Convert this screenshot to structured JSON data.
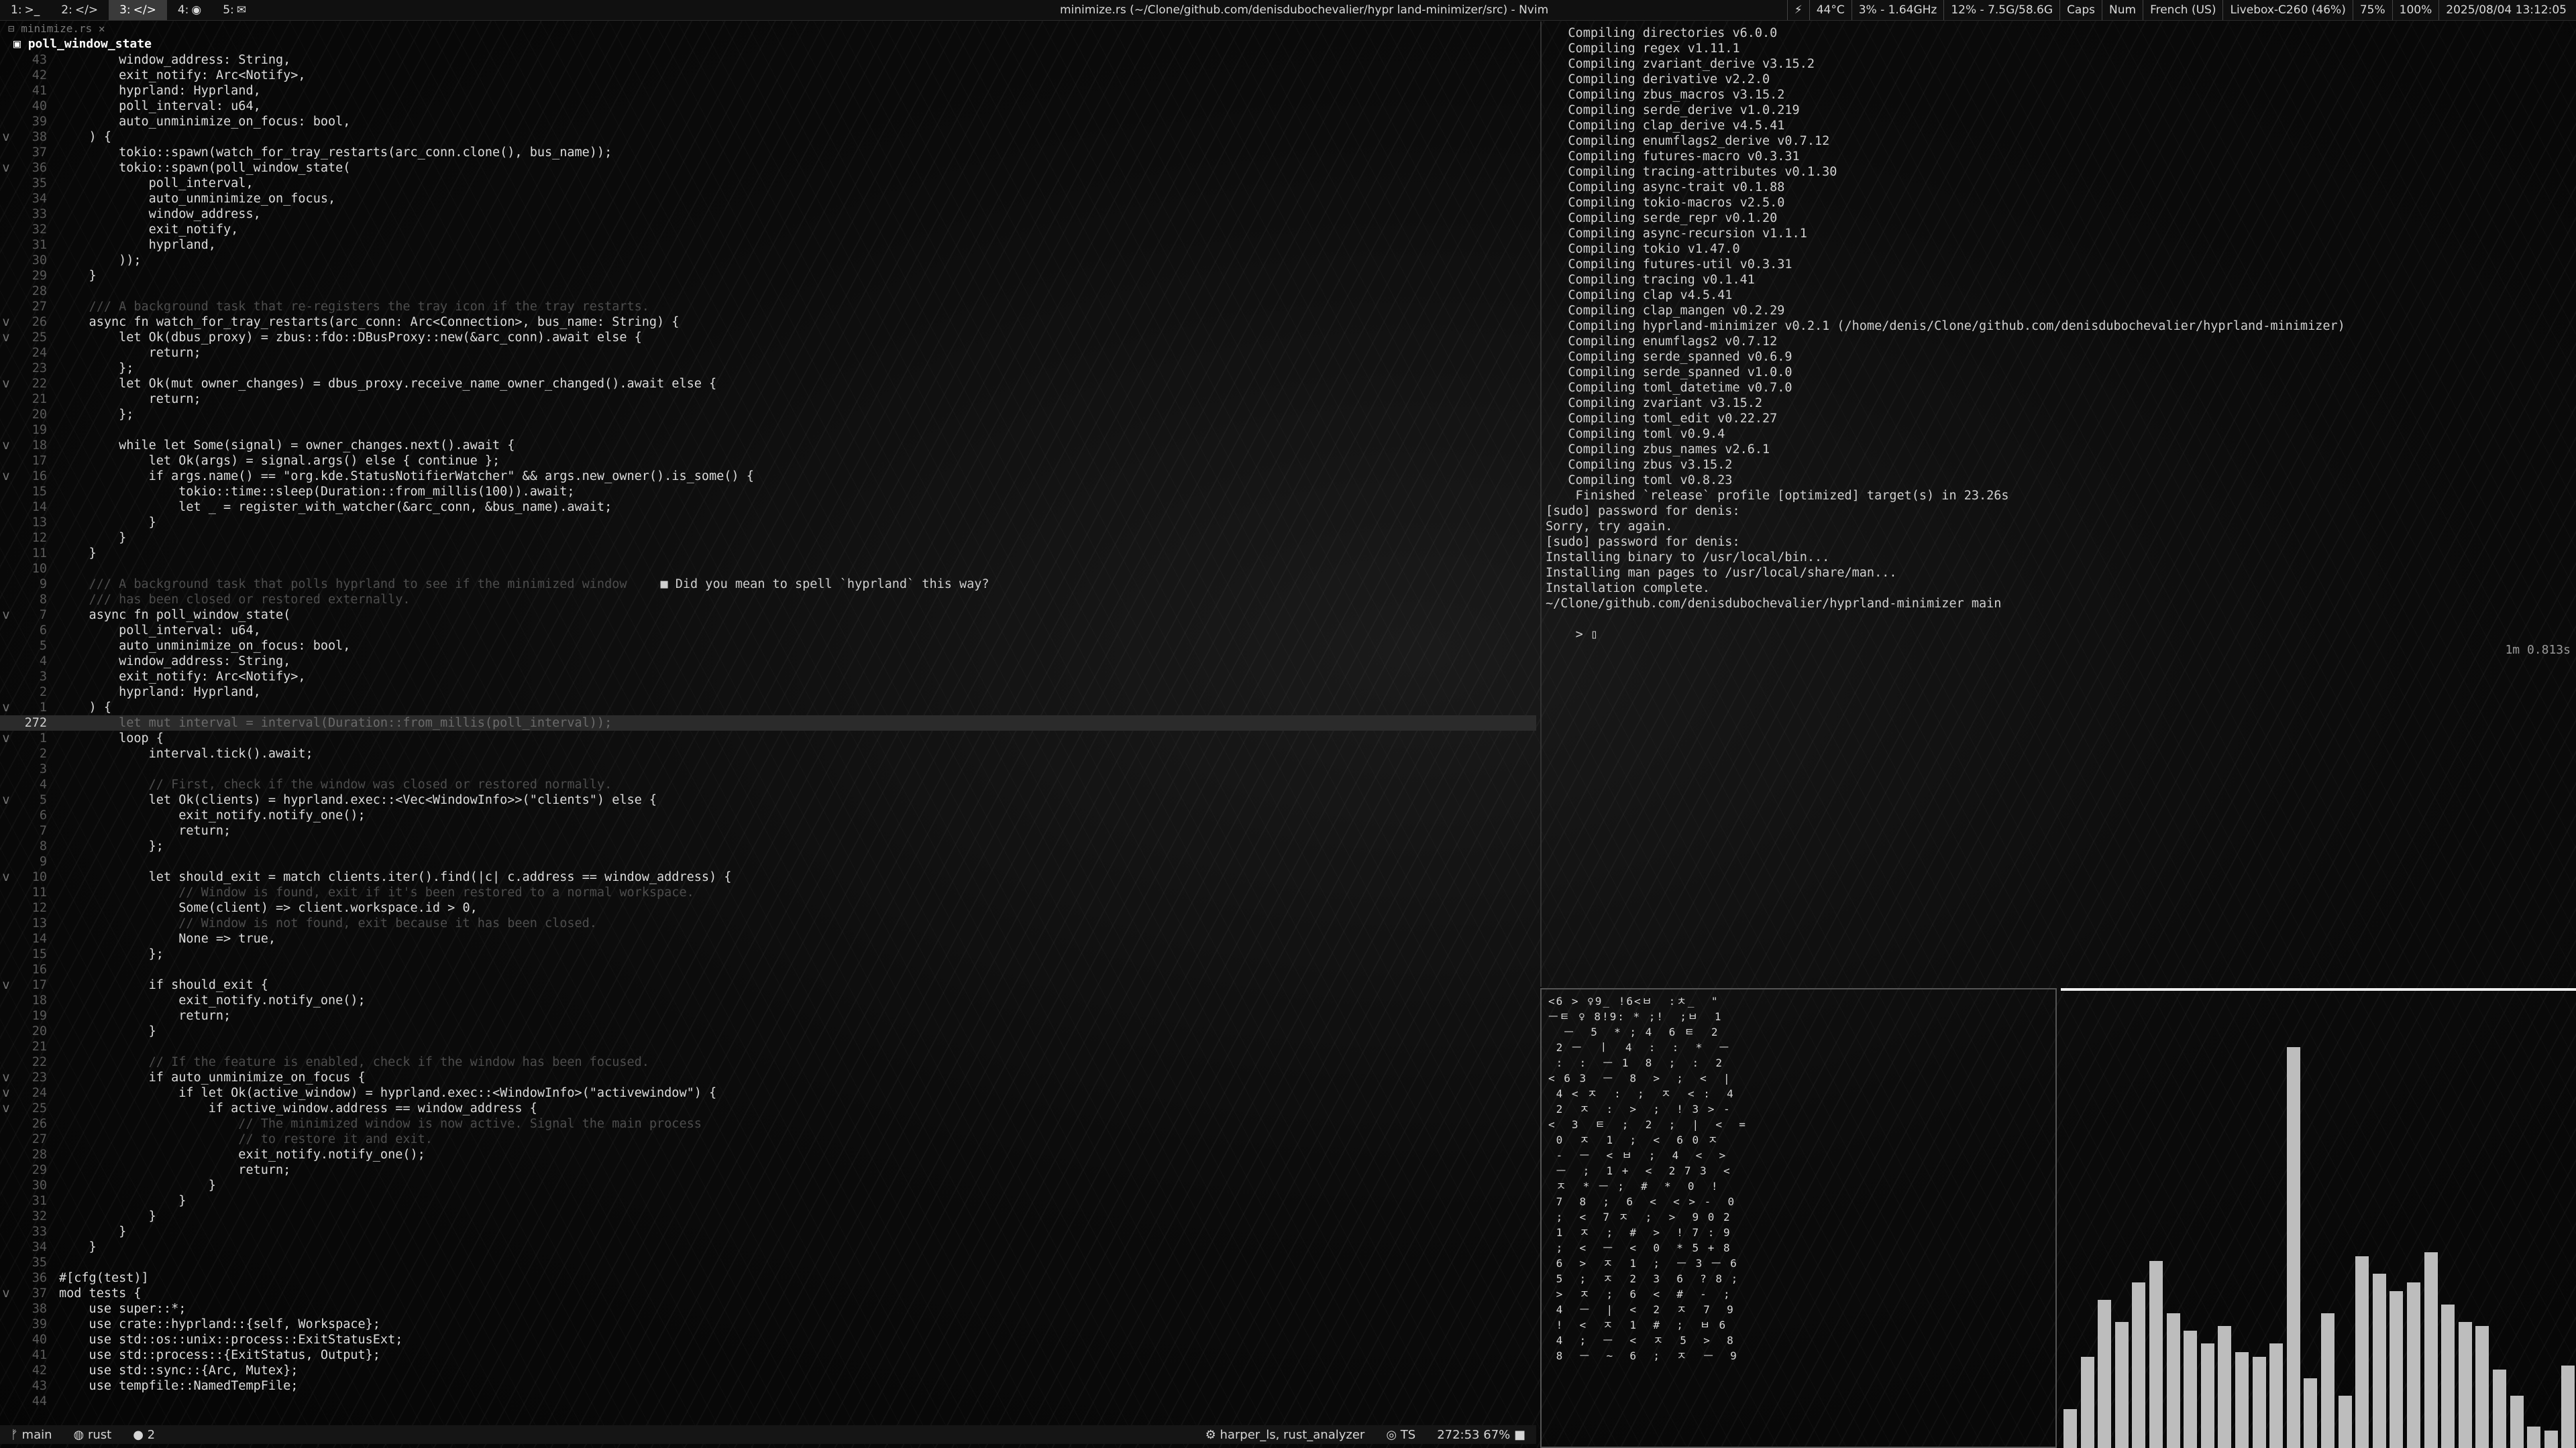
{
  "topbar": {
    "workspaces": [
      {
        "label": "1:",
        "icon": "terminal-icon"
      },
      {
        "label": "2:",
        "icon": "code-icon"
      },
      {
        "label": "3:",
        "icon": "code-icon"
      },
      {
        "label": "4:",
        "icon": "globe-icon"
      },
      {
        "label": "5:",
        "icon": "chat-icon"
      }
    ],
    "active_workspace": "3:",
    "window_title": "minimize.rs (~/Clone/github.com/denisdubochevalier/hypr land-minimizer/src) - Nvim",
    "modules": [
      "⚡",
      "44°C",
      "3% - 1.64GHz",
      "12% - 7.5G/58.6G",
      "Caps",
      "Num",
      "French (US)",
      "Livebox-C260 (46%)",
      "75%",
      "100%",
      "2025/08/04 13:12:05"
    ]
  },
  "nvim": {
    "tab": "minimize.rs",
    "winbar": "poll_window_state",
    "lines": [
      {
        "n": "43",
        "t": "        window_address: String,"
      },
      {
        "n": "42",
        "t": "        exit_notify: Arc<Notify>,"
      },
      {
        "n": "41",
        "t": "        hyprland: Hyprland,"
      },
      {
        "n": "40",
        "t": "        poll_interval: u64,"
      },
      {
        "n": "39",
        "t": "        auto_unminimize_on_focus: bool,"
      },
      {
        "n": "38",
        "t": "    ) {",
        "f": "v"
      },
      {
        "n": "37",
        "t": "        tokio::spawn(watch_for_tray_restarts(arc_conn.clone(), bus_name));"
      },
      {
        "n": "36",
        "t": "        tokio::spawn(poll_window_state(",
        "f": "v"
      },
      {
        "n": "35",
        "t": "            poll_interval,"
      },
      {
        "n": "34",
        "t": "            auto_unminimize_on_focus,"
      },
      {
        "n": "33",
        "t": "            window_address,"
      },
      {
        "n": "32",
        "t": "            exit_notify,"
      },
      {
        "n": "31",
        "t": "            hyprland,"
      },
      {
        "n": "30",
        "t": "        ));"
      },
      {
        "n": "29",
        "t": "    }"
      },
      {
        "n": "28",
        "t": ""
      },
      {
        "n": "27",
        "t": "    /// A background task that re-registers the tray icon if the tray restarts.",
        "c": true
      },
      {
        "n": "26",
        "t": "    async fn watch_for_tray_restarts(arc_conn: Arc<Connection>, bus_name: String) {",
        "f": "v"
      },
      {
        "n": "25",
        "t": "        let Ok(dbus_proxy) = zbus::fdo::DBusProxy::new(&arc_conn).await else {",
        "f": "v"
      },
      {
        "n": "24",
        "t": "            return;"
      },
      {
        "n": "23",
        "t": "        };"
      },
      {
        "n": "22",
        "t": "        let Ok(mut owner_changes) = dbus_proxy.receive_name_owner_changed().await else {",
        "f": "v"
      },
      {
        "n": "21",
        "t": "            return;"
      },
      {
        "n": "20",
        "t": "        };"
      },
      {
        "n": "19",
        "t": ""
      },
      {
        "n": "18",
        "t": "        while let Some(signal) = owner_changes.next().await {",
        "f": "v"
      },
      {
        "n": "17",
        "t": "            let Ok(args) = signal.args() else { continue };"
      },
      {
        "n": "16",
        "t": "            if args.name() == \"org.kde.StatusNotifierWatcher\" && args.new_owner().is_some() {",
        "f": "v"
      },
      {
        "n": "15",
        "t": "                tokio::time::sleep(Duration::from_millis(100)).await;"
      },
      {
        "n": "14",
        "t": "                let _ = register_with_watcher(&arc_conn, &bus_name).await;"
      },
      {
        "n": "13",
        "t": "            }"
      },
      {
        "n": "12",
        "t": "        }"
      },
      {
        "n": "11",
        "t": "    }"
      },
      {
        "n": "10",
        "t": ""
      },
      {
        "n": "9",
        "t": "    /// A background task that polls hyprland to see if the minimized window",
        "c": true,
        "diag": "■ Did you mean to spell `hyprland` this way?"
      },
      {
        "n": "8",
        "t": "    /// has been closed or restored externally.",
        "c": true
      },
      {
        "n": "7",
        "t": "    async fn poll_window_state(",
        "f": "v"
      },
      {
        "n": "6",
        "t": "        poll_interval: u64,"
      },
      {
        "n": "5",
        "t": "        auto_unminimize_on_focus: bool,"
      },
      {
        "n": "4",
        "t": "        window_address: String,"
      },
      {
        "n": "3",
        "t": "        exit_notify: Arc<Notify>,"
      },
      {
        "n": "2",
        "t": "        hyprland: Hyprland,"
      },
      {
        "n": "1",
        "t": "    ) {",
        "f": "v"
      },
      {
        "n": "272",
        "t": "        let mut interval = interval(Duration::from_millis(poll_interval));",
        "cur": true
      },
      {
        "n": "1",
        "t": "        loop {",
        "f": "v"
      },
      {
        "n": "2",
        "t": "            interval.tick().await;"
      },
      {
        "n": "3",
        "t": ""
      },
      {
        "n": "4",
        "t": "            // First, check if the window was closed or restored normally.",
        "c": true
      },
      {
        "n": "5",
        "t": "            let Ok(clients) = hyprland.exec::<Vec<WindowInfo>>(\"clients\") else {",
        "f": "v"
      },
      {
        "n": "6",
        "t": "                exit_notify.notify_one();"
      },
      {
        "n": "7",
        "t": "                return;"
      },
      {
        "n": "8",
        "t": "            };"
      },
      {
        "n": "9",
        "t": ""
      },
      {
        "n": "10",
        "t": "            let should_exit = match clients.iter().find(|c| c.address == window_address) {",
        "f": "v"
      },
      {
        "n": "11",
        "t": "                // Window is found, exit if it's been restored to a normal workspace.",
        "c": true
      },
      {
        "n": "12",
        "t": "                Some(client) => client.workspace.id > 0,"
      },
      {
        "n": "13",
        "t": "                // Window is not found, exit because it has been closed.",
        "c": true
      },
      {
        "n": "14",
        "t": "                None => true,"
      },
      {
        "n": "15",
        "t": "            };"
      },
      {
        "n": "16",
        "t": ""
      },
      {
        "n": "17",
        "t": "            if should_exit {",
        "f": "v"
      },
      {
        "n": "18",
        "t": "                exit_notify.notify_one();"
      },
      {
        "n": "19",
        "t": "                return;"
      },
      {
        "n": "20",
        "t": "            }"
      },
      {
        "n": "21",
        "t": ""
      },
      {
        "n": "22",
        "t": "            // If the feature is enabled, check if the window has been focused.",
        "c": true
      },
      {
        "n": "23",
        "t": "            if auto_unminimize_on_focus {",
        "f": "v"
      },
      {
        "n": "24",
        "t": "                if let Ok(active_window) = hyprland.exec::<WindowInfo>(\"activewindow\") {",
        "f": "v"
      },
      {
        "n": "25",
        "t": "                    if active_window.address == window_address {",
        "f": "v"
      },
      {
        "n": "26",
        "t": "                        // The minimized window is now active. Signal the main process",
        "c": true
      },
      {
        "n": "27",
        "t": "                        // to restore it and exit.",
        "c": true
      },
      {
        "n": "28",
        "t": "                        exit_notify.notify_one();"
      },
      {
        "n": "29",
        "t": "                        return;"
      },
      {
        "n": "30",
        "t": "                    }"
      },
      {
        "n": "31",
        "t": "                }"
      },
      {
        "n": "32",
        "t": "            }"
      },
      {
        "n": "33",
        "t": "        }"
      },
      {
        "n": "34",
        "t": "    }"
      },
      {
        "n": "35",
        "t": ""
      },
      {
        "n": "36",
        "t": "#[cfg(test)]"
      },
      {
        "n": "37",
        "t": "mod tests {",
        "f": "v"
      },
      {
        "n": "38",
        "t": "    use super::*;"
      },
      {
        "n": "39",
        "t": "    use crate::hyprland::{self, Workspace};"
      },
      {
        "n": "40",
        "t": "    use std::os::unix::process::ExitStatusExt;"
      },
      {
        "n": "41",
        "t": "    use std::process::{ExitStatus, Output};"
      },
      {
        "n": "42",
        "t": "    use std::sync::{Arc, Mutex};"
      },
      {
        "n": "43",
        "t": "    use tempfile::NamedTempFile;"
      },
      {
        "n": "44",
        "t": ""
      }
    ],
    "status": {
      "branch": "main",
      "lang": "rust",
      "diagnostics": "2",
      "lsp": "harper_ls, rust_analyzer",
      "ts": "TS",
      "position": "272:53",
      "percent": "67%"
    }
  },
  "terminal": {
    "lines": [
      "   Compiling directories v6.0.0",
      "   Compiling regex v1.11.1",
      "   Compiling zvariant_derive v3.15.2",
      "   Compiling derivative v2.2.0",
      "   Compiling zbus_macros v3.15.2",
      "   Compiling serde_derive v1.0.219",
      "   Compiling clap_derive v4.5.41",
      "   Compiling enumflags2_derive v0.7.12",
      "   Compiling futures-macro v0.3.31",
      "   Compiling tracing-attributes v0.1.30",
      "   Compiling async-trait v0.1.88",
      "   Compiling tokio-macros v2.5.0",
      "   Compiling serde_repr v0.1.20",
      "   Compiling async-recursion v1.1.1",
      "   Compiling tokio v1.47.0",
      "   Compiling futures-util v0.3.31",
      "   Compiling tracing v0.1.41",
      "   Compiling clap v4.5.41",
      "   Compiling clap_mangen v0.2.29",
      "   Compiling hyprland-minimizer v0.2.1 (/home/denis/Clone/github.com/denisdubochevalier/hyprland-minimizer)",
      "   Compiling enumflags2 v0.7.12",
      "   Compiling serde_spanned v0.6.9",
      "   Compiling serde_spanned v1.0.0",
      "   Compiling toml_datetime v0.7.0",
      "   Compiling zvariant v3.15.2",
      "   Compiling toml_edit v0.22.27",
      "   Compiling toml v0.9.4",
      "   Compiling zbus_names v2.6.1",
      "   Compiling zbus v3.15.2",
      "   Compiling toml v0.8.23",
      "    Finished `release` profile [optimized] target(s) in 23.26s",
      "[sudo] password for denis:",
      "Sorry, try again.",
      "[sudo] password for denis:",
      "Installing binary to /usr/local/bin...",
      "Installing man pages to /usr/local/share/man...",
      "Installation complete.",
      "",
      "~/Clone/github.com/denisdubochevalier/hyprland-minimizer main"
    ],
    "prompt": "> ▯",
    "elapsed": "1m 0.813s"
  },
  "matrix": {
    "rows": [
      "<6 > ♀9_ !6<ㅂ  :ㅊ_  \"",
      "ㅡㅌ ♀ 8!9: * ;!  ;ㅂ  1",
      "  ㅡ  5  * ; 4  6 ㅌ  2",
      " 2 ㅡ  ㅣ  4  :  :  *  ㅡ",
      " :  :  ㅡ 1  8  ;  :  2",
      "< 6 3  ㅡ  8  >  ;  <  |",
      " 4 < ㅈ  :  ;  ㅈ  < :  4",
      " 2  ㅈ  :  >  ;  ! 3 > -",
      "<  3  ㅌ  ;  2  ;  |  <  =",
      " 0  ㅈ  1  ;  <  6 0 ㅈ",
      " -  ㅡ  < ㅂ  ;  4  <  >",
      " ㅡ  ;  1 +  <  2 7 3  <",
      " ㅈ  * ㅡ ;  #  *  0  !",
      " 7  8  ;  6  <  < > -  0",
      " ;  <  7 ㅈ  ;  >  9 0 2",
      " 1  ㅈ  ;  #  >  ! 7 : 9",
      " ;  <  ㅡ  <  0  * 5 + 8",
      " 6  >  ㅈ  1  ;  ㅡ 3 ㅡ 6",
      " 5  ;  ㅈ  2  3  6  ? 8 ;",
      " >  ㅈ  ;  6  <  #  -  ;",
      " 4  ㅡ  |  <  2  ㅈ  7  9",
      " !  <  ㅈ  1  #  ;  ㅂ 6",
      " 4  ;  ㅡ  <  ㅈ  5  >  8",
      " 8  ㅡ  ~  6  ;  ㅈ  ㅡ  9"
    ]
  },
  "cava": {
    "levels": [
      0.09,
      0.21,
      0.34,
      0.29,
      0.38,
      0.43,
      0.31,
      0.27,
      0.24,
      0.28,
      0.22,
      0.21,
      0.24,
      0.92,
      0.16,
      0.31,
      0.12,
      0.44,
      0.4,
      0.36,
      0.38,
      0.45,
      0.33,
      0.29,
      0.28,
      0.18,
      0.12,
      0.05,
      0.04,
      0.19
    ]
  }
}
